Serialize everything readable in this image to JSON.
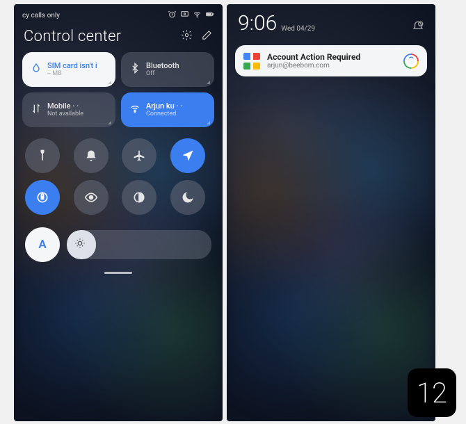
{
  "left": {
    "status_text": "cy calls only",
    "title": "Control center",
    "tiles": {
      "sim": {
        "title": "SIM card isn't i",
        "sub": "-- MB"
      },
      "bluetooth": {
        "title": "Bluetooth",
        "sub": "Off"
      },
      "mobile": {
        "title": "Mobile · ·",
        "sub": "Not available"
      },
      "wifi": {
        "title": "Arjun ku · ·",
        "sub": "Connected"
      }
    },
    "auto_label": "A"
  },
  "right": {
    "time": "9:06",
    "date": "Wed 04/29",
    "notification": {
      "title": "Account Action Required",
      "sub": "arjun@beebom.com"
    }
  },
  "badge": "12"
}
